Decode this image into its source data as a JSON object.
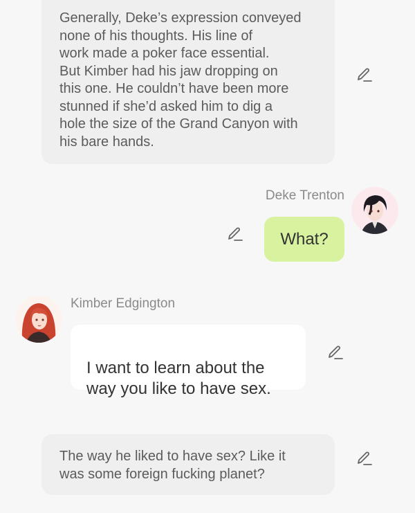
{
  "messages": {
    "narration_1": {
      "text": "Generally, Deke’s expression conveyed\nnone of his thoughts. His line of\nwork made a poker face essential.\nBut Kimber had his jaw dropping on\nthis one. He couldn’t have been more\nstunned if she’d asked him to dig a\nhole the size of the Grand Canyon with\nhis bare hands."
    },
    "deke": {
      "name": "Deke Trenton",
      "text": "What?"
    },
    "kimber": {
      "name": "Kimber Edgington",
      "text": "I want to learn about the\nway you like to have sex."
    },
    "narration_2": {
      "text": "The way he liked to have sex? Like it\nwas some foreign fucking planet?"
    }
  },
  "icons": {
    "edit": "pencil-edit-icon"
  },
  "colors": {
    "background": "#f7f7f7",
    "narration_bubble": "#efefef",
    "own_bubble": "#d8f2a0",
    "other_bubble": "#ffffff",
    "name_text": "#8a8a8a"
  }
}
